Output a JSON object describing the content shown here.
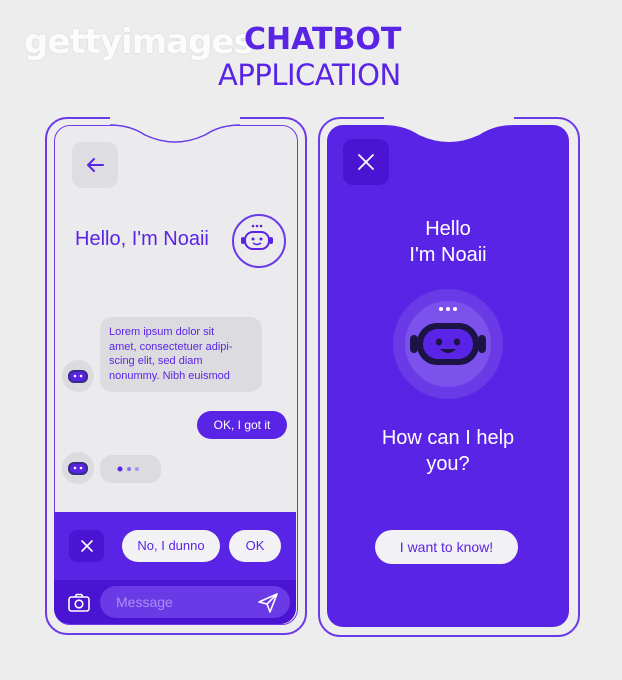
{
  "watermark": "gettyimages",
  "header": {
    "title": "CHATBOT",
    "subtitle": "APPLICATION"
  },
  "left_phone": {
    "greeting": "Hello, I'm Noaii",
    "bot_message": [
      "Lorem ipsum dolor sit",
      "amet, consectetuer adipi-",
      "scing elit, sed diam",
      "nonummy. Nibh euismod"
    ],
    "user_reply": "OK, I got it",
    "quick_replies": [
      "No, I dunno",
      "OK"
    ],
    "message_placeholder": "Message"
  },
  "right_phone": {
    "greeting_line1": "Hello",
    "greeting_line2": "I'm Noaii",
    "help_line1": "How can I help",
    "help_line2": "you?",
    "cta": "I want to know!"
  },
  "colors": {
    "accent": "#5a24e6",
    "panel": "#ebeaec",
    "bubble": "#dcdbdf"
  }
}
